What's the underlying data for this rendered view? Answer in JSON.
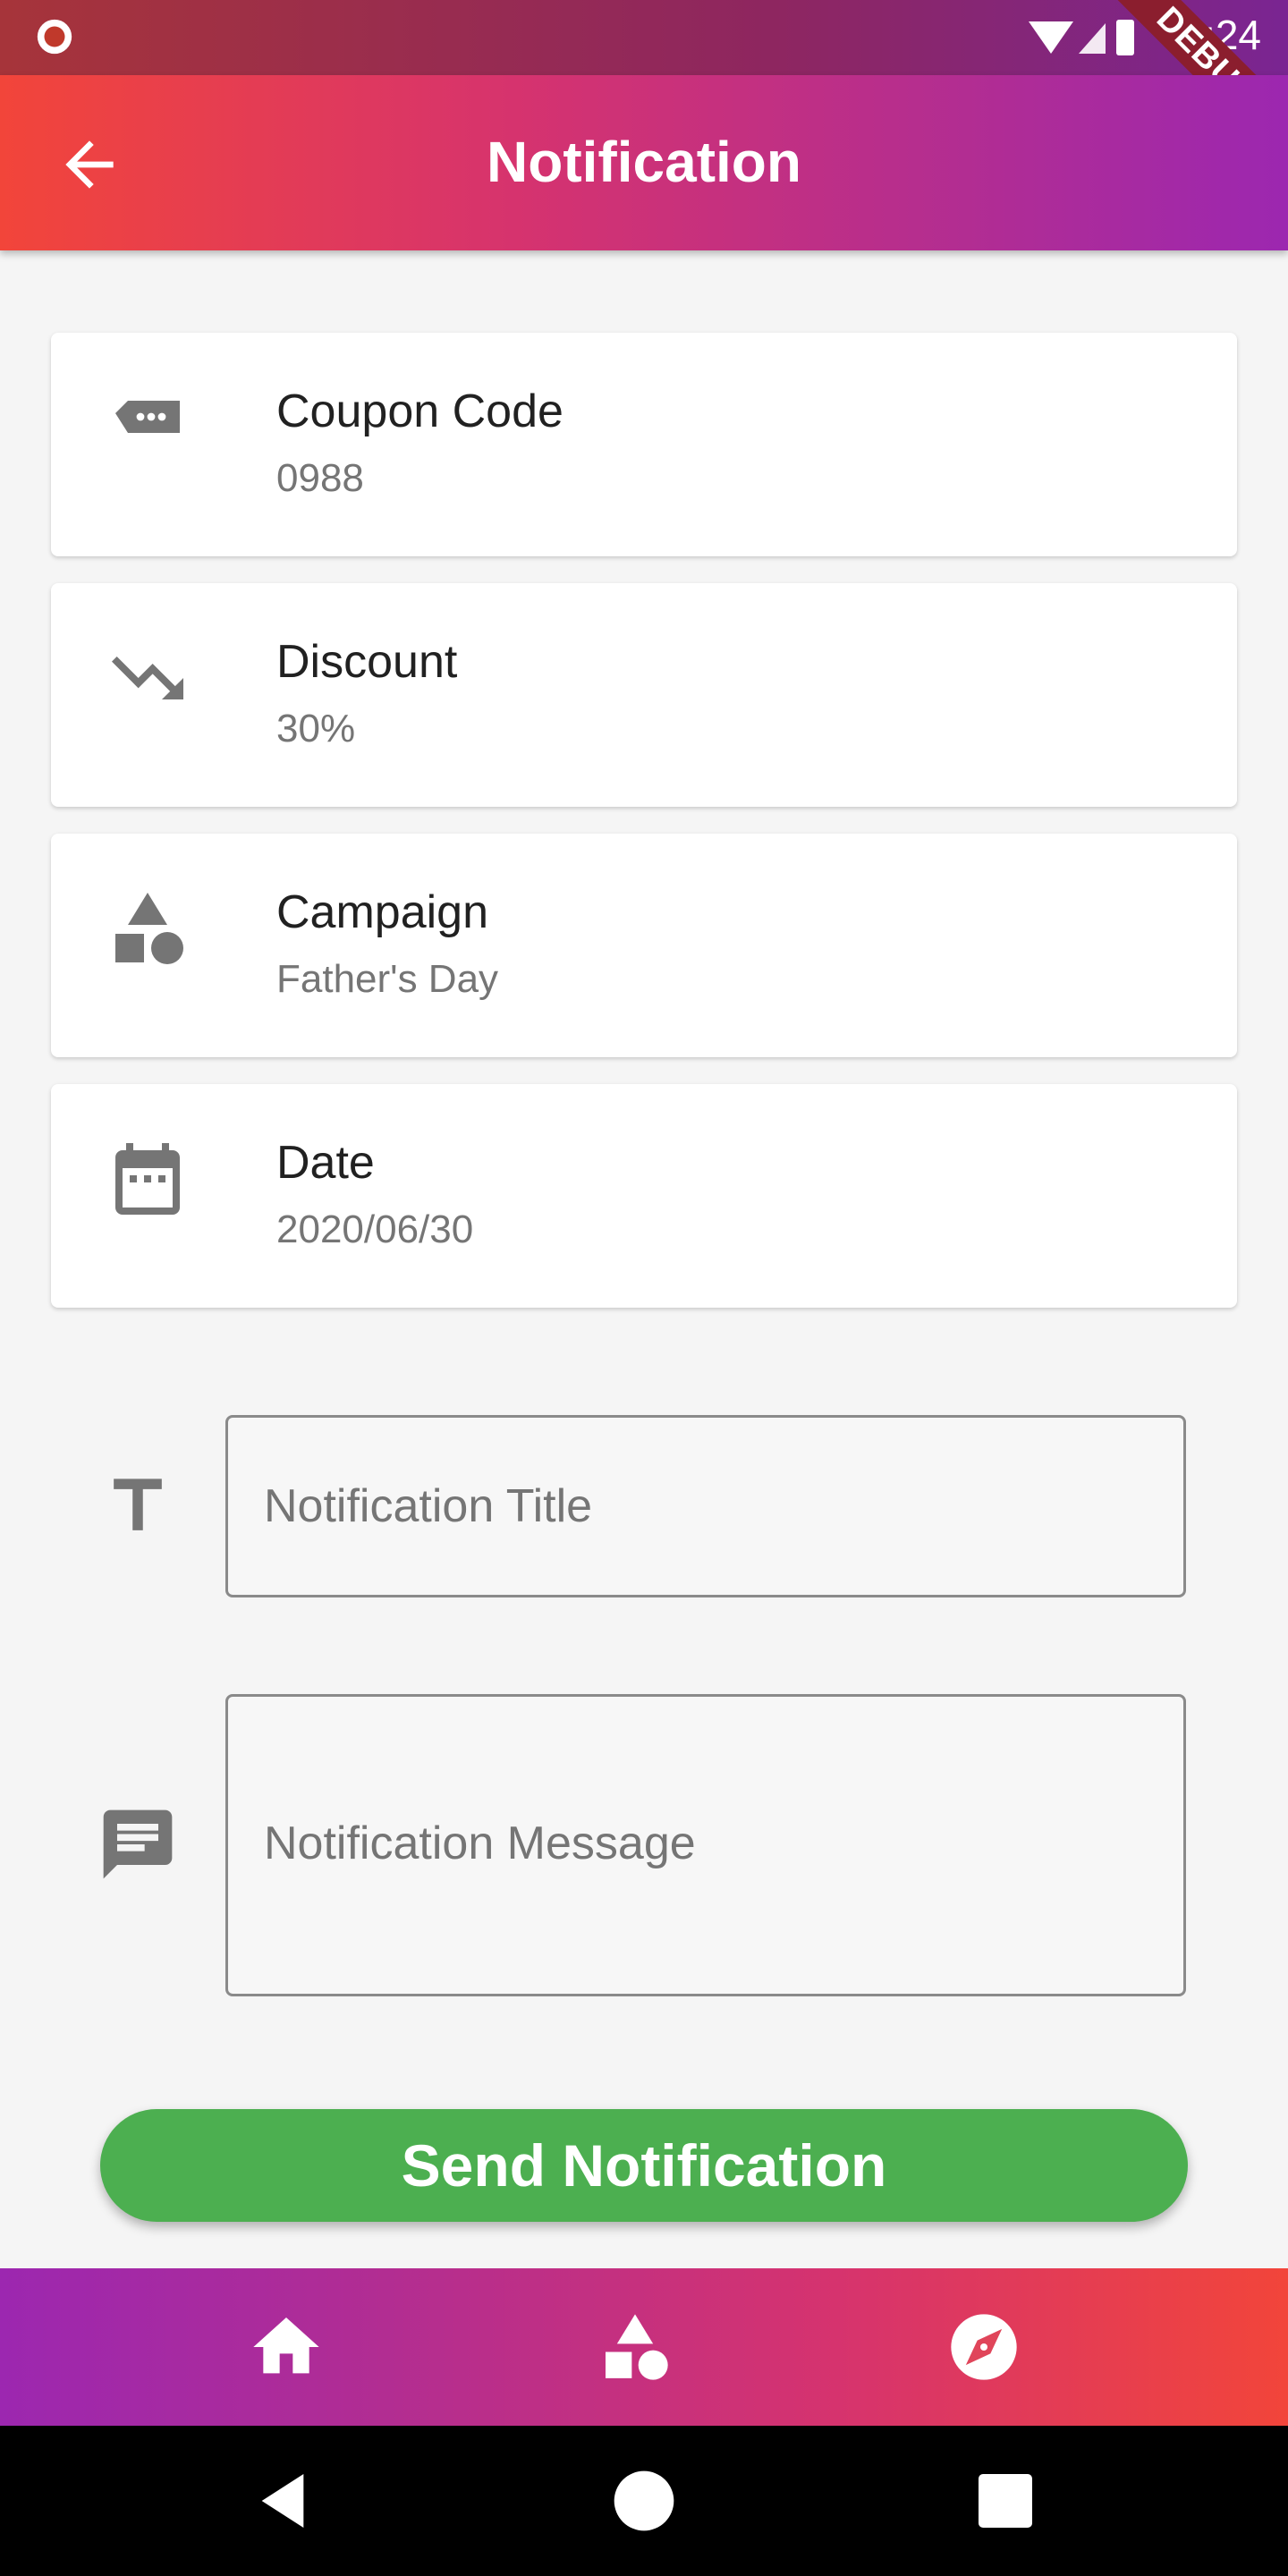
{
  "status_bar": {
    "time": "2:24",
    "debug_label": "DEBUG"
  },
  "app_bar": {
    "title": "Notification"
  },
  "cards": [
    {
      "title": "Coupon Code",
      "value": "0988",
      "icon": "tag-icon"
    },
    {
      "title": "Discount",
      "value": "30%",
      "icon": "trending-down-icon"
    },
    {
      "title": "Campaign",
      "value": "Father's Day",
      "icon": "category-icon"
    },
    {
      "title": "Date",
      "value": "2020/06/30",
      "icon": "calendar-icon"
    }
  ],
  "form": {
    "title_placeholder": "Notification Title",
    "message_placeholder": "Notification Message"
  },
  "send_button": {
    "label": "Send Notification"
  },
  "bottom_nav": [
    "home-icon",
    "category-icon",
    "explore-icon"
  ],
  "colors": {
    "accent_start": "#f2453a",
    "accent_end": "#9c27b0",
    "send_button": "#4caf50"
  }
}
